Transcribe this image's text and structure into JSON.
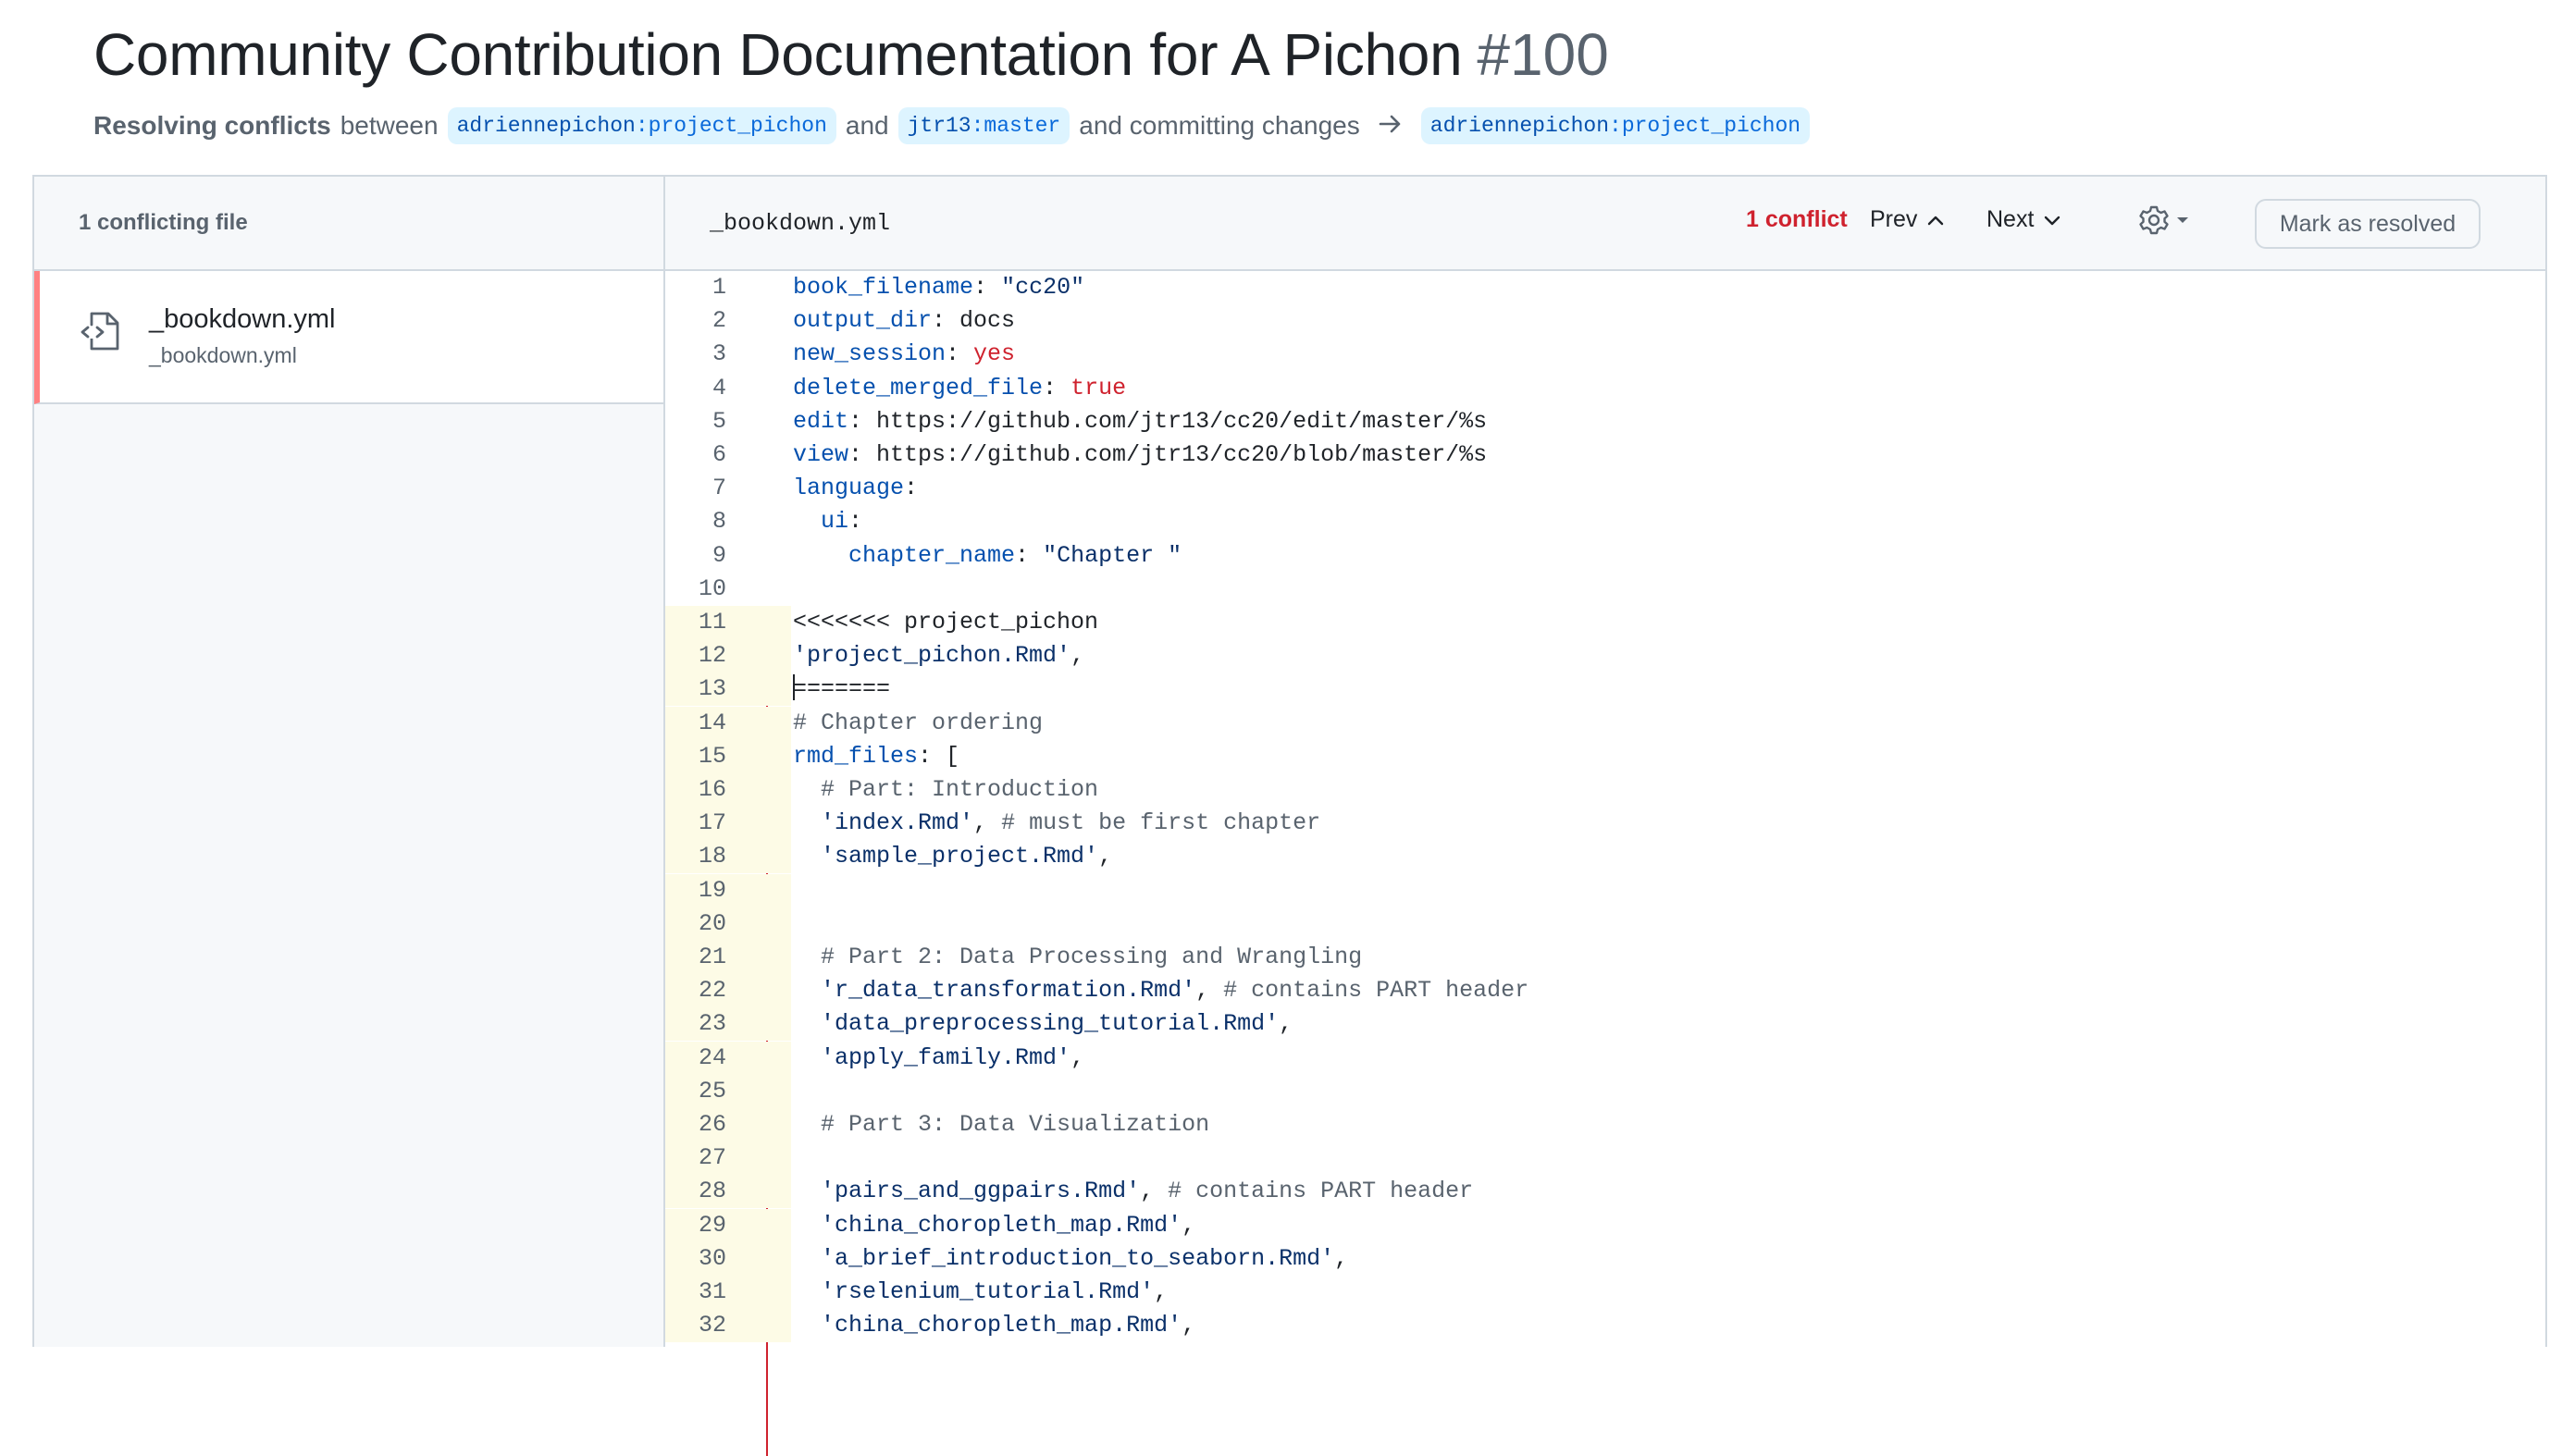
{
  "header": {
    "title": "Community Contribution Documentation for A Pichon",
    "pr_number": "#100",
    "resolving_label": "Resolving conflicts",
    "between_text": "between",
    "and_text": "and",
    "committing_text": "and committing changes",
    "head_branch": {
      "user": "adriennepichon",
      "colon": ":",
      "name": "project_pichon"
    },
    "base_branch": {
      "user": "jtr13",
      "colon": ":",
      "name": "master"
    },
    "target_branch": {
      "user": "adriennepichon",
      "colon": ":",
      "name": "project_pichon"
    }
  },
  "sidebar": {
    "heading": "1 conflicting file",
    "files": [
      {
        "name": "_bookdown.yml",
        "path": "_bookdown.yml",
        "icon": "file-code-icon"
      }
    ]
  },
  "editor": {
    "filename": "_bookdown.yml",
    "conflict_count": "1 conflict",
    "prev_label": "Prev",
    "next_label": "Next",
    "mark_resolved_label": "Mark as resolved",
    "lines": [
      {
        "n": "1",
        "text": "book_filename: \"cc20\""
      },
      {
        "n": "2",
        "text": "output_dir: docs"
      },
      {
        "n": "3",
        "text": "new_session: yes"
      },
      {
        "n": "4",
        "text": "delete_merged_file: true"
      },
      {
        "n": "5",
        "text": "edit: https://github.com/jtr13/cc20/edit/master/%s"
      },
      {
        "n": "6",
        "text": "view: https://github.com/jtr13/cc20/blob/master/%s"
      },
      {
        "n": "7",
        "text": "language:"
      },
      {
        "n": "8",
        "text": "  ui:"
      },
      {
        "n": "9",
        "text": "    chapter_name: \"Chapter \""
      },
      {
        "n": "10",
        "text": ""
      },
      {
        "n": "11",
        "text": "<<<<<<< project_pichon"
      },
      {
        "n": "12",
        "text": "'project_pichon.Rmd',"
      },
      {
        "n": "13",
        "text": "======="
      },
      {
        "n": "14",
        "text": "# Chapter ordering"
      },
      {
        "n": "15",
        "text": "rmd_files: ["
      },
      {
        "n": "16",
        "text": "  # Part: Introduction"
      },
      {
        "n": "17",
        "text": "  'index.Rmd', # must be first chapter"
      },
      {
        "n": "18",
        "text": "  'sample_project.Rmd',"
      },
      {
        "n": "19",
        "text": ""
      },
      {
        "n": "20",
        "text": ""
      },
      {
        "n": "21",
        "text": "  # Part 2: Data Processing and Wrangling"
      },
      {
        "n": "22",
        "text": "  'r_data_transformation.Rmd', # contains PART header"
      },
      {
        "n": "23",
        "text": "  'data_preprocessing_tutorial.Rmd',"
      },
      {
        "n": "24",
        "text": "  'apply_family.Rmd',"
      },
      {
        "n": "25",
        "text": ""
      },
      {
        "n": "26",
        "text": "  # Part 3: Data Visualization"
      },
      {
        "n": "27",
        "text": ""
      },
      {
        "n": "28",
        "text": "  'pairs_and_ggpairs.Rmd', # contains PART header"
      },
      {
        "n": "29",
        "text": "  'china_choropleth_map.Rmd',"
      },
      {
        "n": "30",
        "text": "  'a_brief_introduction_to_seaborn.Rmd',"
      },
      {
        "n": "31",
        "text": "  'rselenium_tutorial.Rmd',"
      },
      {
        "n": "32",
        "text": "  'china_choropleth_map.Rmd',"
      }
    ]
  },
  "colors": {
    "conflict_red": "#cf222e",
    "link_blue": "#0969da",
    "branch_bg": "#ddf4ff",
    "conflict_gutter": "#fdfbe6",
    "sidebar_bg": "#f6f8fa",
    "border": "#d1d9e0"
  }
}
